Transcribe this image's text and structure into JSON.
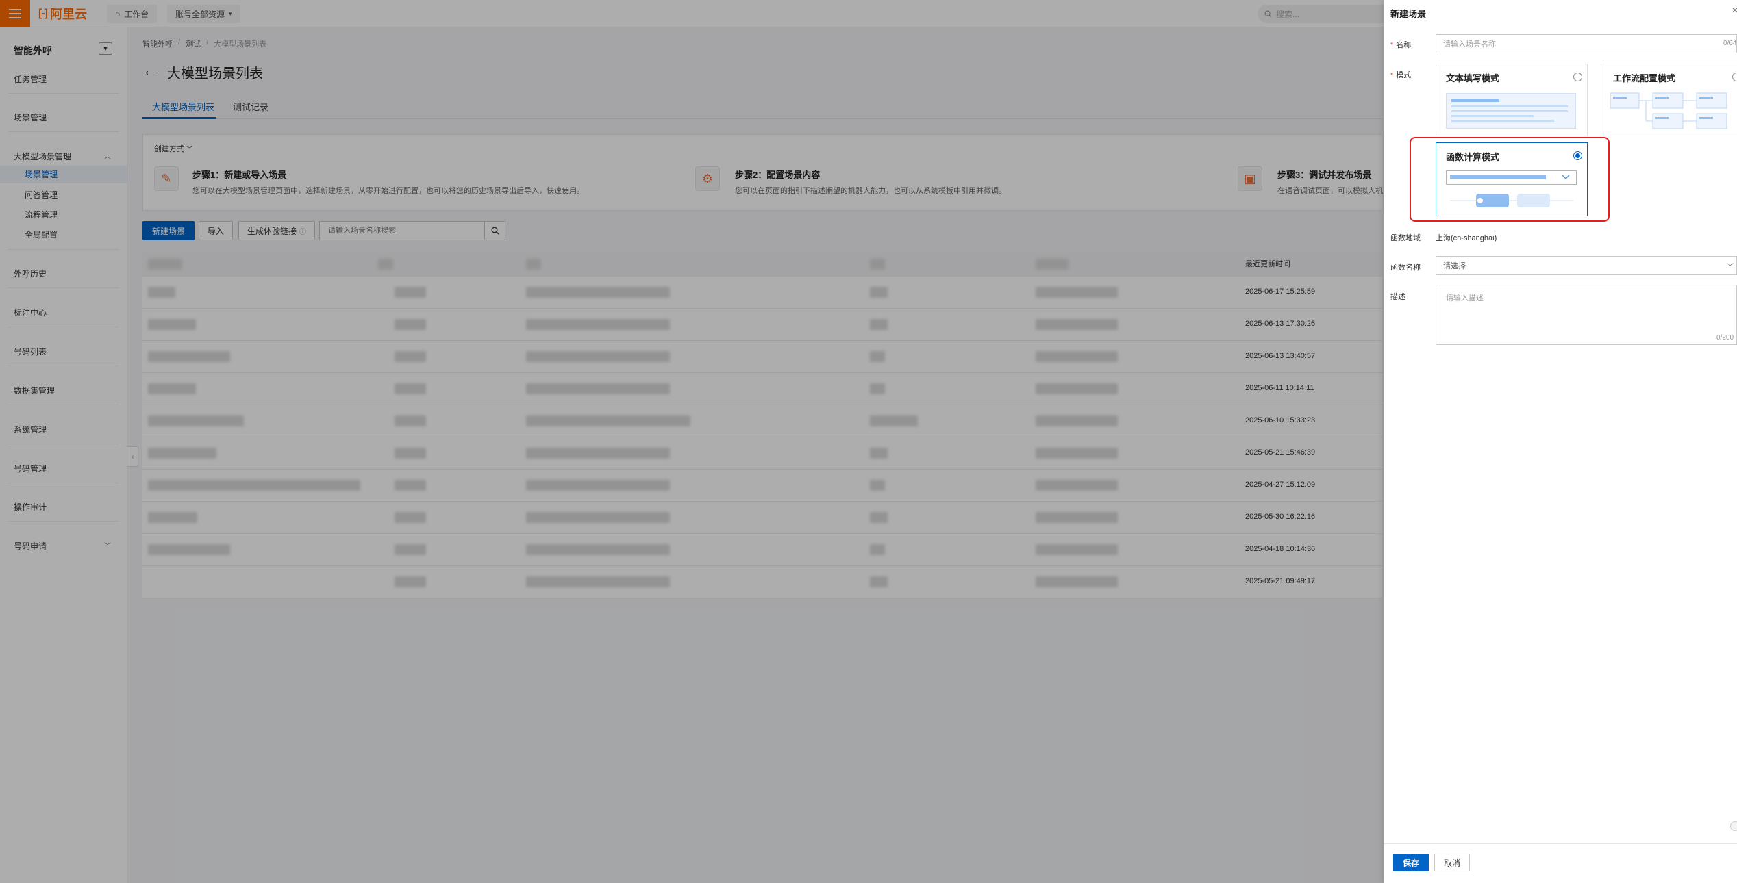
{
  "topbar": {
    "logo_text": "阿里云",
    "workbench": "工作台",
    "account_scope": "账号全部资源",
    "search_placeholder": "搜索..."
  },
  "sidebar": {
    "title": "智能外呼",
    "items": [
      {
        "label": "任务管理"
      },
      {
        "label": "场景管理"
      },
      {
        "label": "大模型场景管理"
      },
      {
        "label": "外呼历史"
      },
      {
        "label": "标注中心"
      },
      {
        "label": "号码列表"
      },
      {
        "label": "数据集管理"
      },
      {
        "label": "系统管理"
      },
      {
        "label": "号码管理"
      },
      {
        "label": "操作审计"
      },
      {
        "label": "号码申请"
      }
    ],
    "subitems": [
      {
        "label": "场景管理"
      },
      {
        "label": "问答管理"
      },
      {
        "label": "流程管理"
      },
      {
        "label": "全局配置"
      }
    ]
  },
  "breadcrumb": [
    "智能外呼",
    "测试",
    "大模型场景列表"
  ],
  "page": {
    "title": "大模型场景列表",
    "tabs": [
      {
        "label": "大模型场景列表"
      },
      {
        "label": "测试记录"
      }
    ]
  },
  "guide": {
    "head": "创建方式",
    "steps": [
      {
        "title": "步骤1：新建或导入场景",
        "desc": "您可以在大模型场景管理页面中，选择新建场景，从零开始进行配置，也可以将您的历史场景导出后导入，快速使用。"
      },
      {
        "title": "步骤2：配置场景内容",
        "desc": "您可以在页面的指引下描述期望的机器人能力，也可以从系统模板中引用并微调。"
      },
      {
        "title": "步骤3：调试并发布场景",
        "desc": "在语音调试页面，可以模拟人机对"
      }
    ]
  },
  "toolbar": {
    "new_scene": "新建场景",
    "import": "导入",
    "gen_link": "生成体验链接",
    "search_placeholder": "请输入场景名称搜索"
  },
  "table": {
    "col_updated": "最近更新时间",
    "rows": [
      {
        "updated": "2025-06-17 15:25:59"
      },
      {
        "updated": "2025-06-13 17:30:26"
      },
      {
        "updated": "2025-06-13 13:40:57"
      },
      {
        "updated": "2025-06-11 10:14:11"
      },
      {
        "updated": "2025-06-10 15:33:23"
      },
      {
        "updated": "2025-05-21 15:46:39"
      },
      {
        "updated": "2025-04-27 15:12:09"
      },
      {
        "updated": "2025-05-30 16:22:16"
      },
      {
        "updated": "2025-04-18 10:14:36"
      },
      {
        "updated": "2025-05-21 09:49:17"
      }
    ]
  },
  "drawer": {
    "title": "新建场景",
    "name_label": "名称",
    "name_placeholder": "请输入场景名称",
    "name_counter": "0/64",
    "mode_label": "模式",
    "modes": [
      {
        "label": "文本填写模式",
        "selected": false
      },
      {
        "label": "工作流配置模式",
        "selected": false
      },
      {
        "label": "函数计算模式",
        "selected": true
      }
    ],
    "region_label": "函数地域",
    "region_value": "上海(cn-shanghai)",
    "func_label": "函数名称",
    "func_placeholder": "请选择",
    "desc_label": "描述",
    "desc_placeholder": "请输入描述",
    "desc_counter": "0/200",
    "save": "保存",
    "cancel": "取消"
  },
  "colors": {
    "brand": "#ff6a00",
    "primary": "#0064c8",
    "highlight": "#e02020"
  }
}
